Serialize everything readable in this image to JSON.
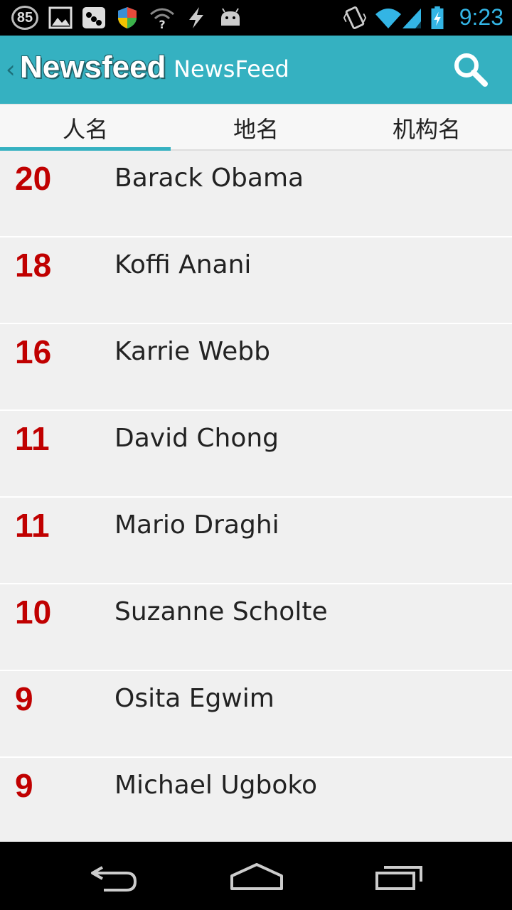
{
  "status_bar": {
    "badge": "85",
    "time": "9:23",
    "icons": [
      "gallery-icon",
      "peas-icon",
      "shield-icon",
      "wifi-question-icon",
      "flash-icon",
      "android-icon",
      "vibrate-icon",
      "wifi-icon",
      "signal-icon",
      "battery-charging-icon"
    ]
  },
  "action_bar": {
    "logo_text": "Newsfeed",
    "title": "NewsFeed",
    "search_icon": "search-icon",
    "color": "#35b1c1"
  },
  "tabs": [
    {
      "label": "人名"
    },
    {
      "label": "地名"
    },
    {
      "label": "机构名"
    }
  ],
  "list": {
    "accent_color": "#c00000",
    "items": [
      {
        "count": "20",
        "name": "Barack Obama"
      },
      {
        "count": "18",
        "name": "Koffi Anani"
      },
      {
        "count": "16",
        "name": "Karrie Webb"
      },
      {
        "count": "11",
        "name": "David Chong"
      },
      {
        "count": "11",
        "name": "Mario Draghi"
      },
      {
        "count": "10",
        "name": "Suzanne Scholte"
      },
      {
        "count": "9",
        "name": "Osita Egwim"
      },
      {
        "count": "9",
        "name": "Michael Ugboko"
      }
    ]
  },
  "nav_bar": {
    "icons": [
      "back-icon",
      "home-icon",
      "recent-apps-icon"
    ]
  }
}
